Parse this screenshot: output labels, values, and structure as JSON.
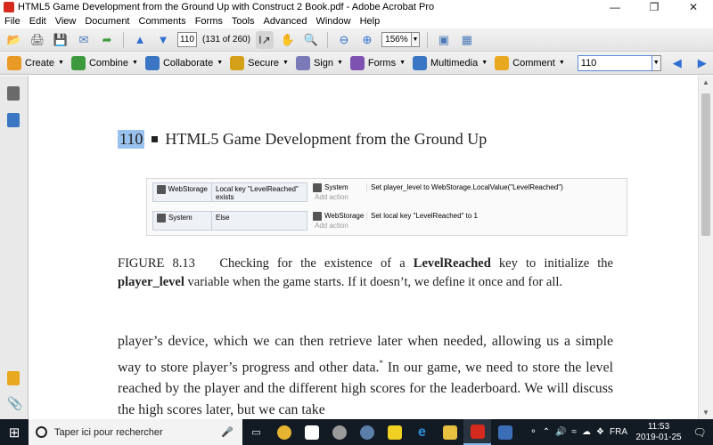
{
  "window": {
    "title": "HTML5 Game Development from the Ground Up with Construct 2 Book.pdf - Adobe Acrobat Pro",
    "minimize": "—",
    "restore": "❐",
    "close": "✕"
  },
  "menu": [
    "File",
    "Edit",
    "View",
    "Document",
    "Comments",
    "Forms",
    "Tools",
    "Advanced",
    "Window",
    "Help"
  ],
  "toolbar1": {
    "page_input": "110",
    "page_count": "(131 of 260)",
    "zoom": "156%"
  },
  "toolbar2": {
    "items": [
      {
        "label": "Create",
        "icon": "create-icon",
        "color": "#e89a24"
      },
      {
        "label": "Combine",
        "icon": "combine-icon",
        "color": "#3c9a3c"
      },
      {
        "label": "Collaborate",
        "icon": "collaborate-icon",
        "color": "#3a76c4"
      },
      {
        "label": "Secure",
        "icon": "lock-icon",
        "color": "#d4a017"
      },
      {
        "label": "Sign",
        "icon": "pen-icon",
        "color": "#7a7ab8"
      },
      {
        "label": "Forms",
        "icon": "forms-icon",
        "color": "#7d52b0"
      },
      {
        "label": "Multimedia",
        "icon": "multimedia-icon",
        "color": "#3a76c4"
      },
      {
        "label": "Comment",
        "icon": "comment-icon",
        "color": "#e8a820"
      }
    ],
    "search_value": "110"
  },
  "page": {
    "page_number": "110",
    "header": "HTML5 Game Development from the Ground Up",
    "figure": {
      "rows": [
        {
          "object": "WebStorage",
          "condition": "Local key \"LevelReached\" exists",
          "action_object": "System",
          "action_text": "Set player_level to WebStorage.LocalValue(\"LevelReached\")",
          "add_action": "Add action"
        },
        {
          "object": "System",
          "condition": "Else",
          "action_object": "WebStorage",
          "action_text": "Set local key \"LevelReached\" to 1",
          "add_action": "Add action"
        }
      ]
    },
    "caption_prefix": "FIGURE 8.13",
    "caption_1": "Checking for the existence of a ",
    "caption_bold_1": "LevelReached",
    "caption_2": " key to initialize the ",
    "caption_bold_2": "player_level",
    "caption_3": " variable when the game starts. If it doesn’t, we define it once and for all.",
    "body_1": "player’s device, which we can then retrieve later when needed, allowing us a simple way to store player’s progress and other data.",
    "body_footnote": "*",
    "body_2": " In our game, we need to store the level reached by the player and the different high scores for the leaderboard. We will discuss the high scores later, but we can take"
  },
  "taskbar": {
    "search_placeholder": "Taper ici pour rechercher",
    "apps": [
      {
        "name": "task-view-icon",
        "color": "#ffffff"
      },
      {
        "name": "chrome-icon",
        "color": "#e6b430"
      },
      {
        "name": "store-icon",
        "color": "#ffffff"
      },
      {
        "name": "settings-app-icon",
        "color": "#9a9a9a"
      },
      {
        "name": "steam-icon",
        "color": "#5a7ea8"
      },
      {
        "name": "notes-icon",
        "color": "#f0d020"
      },
      {
        "name": "edge-icon",
        "color": "#2f8fd8"
      },
      {
        "name": "explorer-icon",
        "color": "#e8c040"
      },
      {
        "name": "acrobat-icon",
        "color": "#d62a1e"
      },
      {
        "name": "photos-icon",
        "color": "#3a6fb8"
      }
    ],
    "lang": "FRA",
    "time": "11:53",
    "date": "2019-01-25"
  }
}
